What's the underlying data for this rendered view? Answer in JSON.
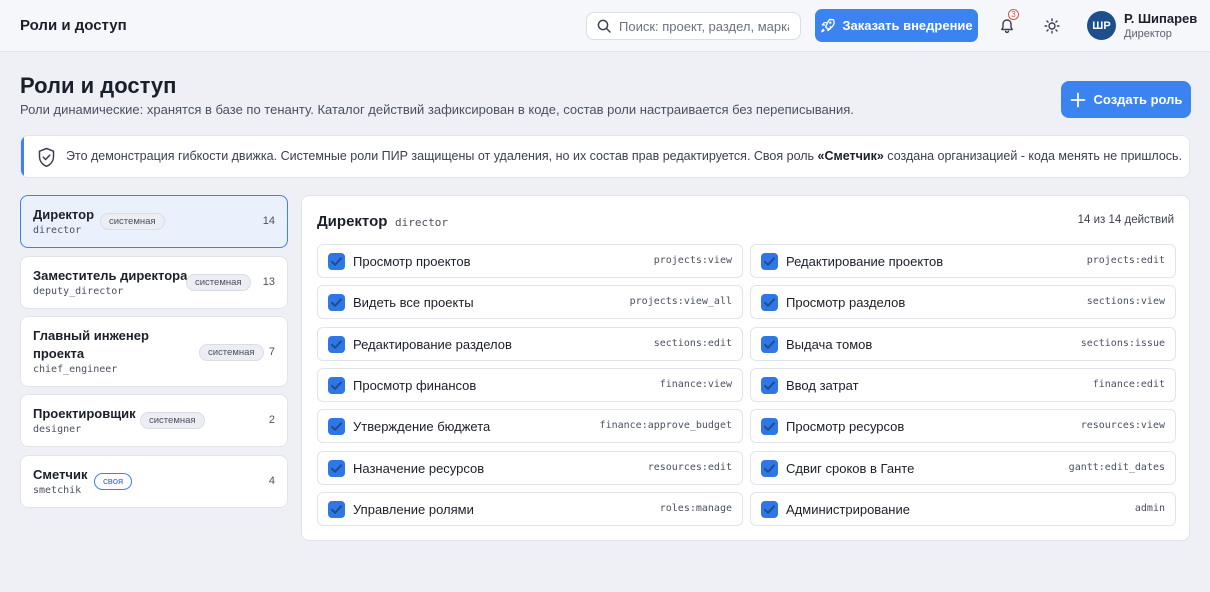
{
  "app": {
    "title": "Роли и доступ"
  },
  "search": {
    "placeholder": "Поиск: проект, раздел, марка"
  },
  "topbar": {
    "order_label": "Заказать внедрение",
    "notifications_count": "3",
    "user_initials": "ШР",
    "user_name": "Р. Шипарев",
    "user_role": "Директор"
  },
  "header": {
    "title": "Роли и доступ",
    "subtitle": "Роли динамические: хранятся в базе по тенанту. Каталог действий зафиксирован в коде, состав роли настраивается без переписывания.",
    "create_label": "Создать роль"
  },
  "banner": {
    "text_before": "Это демонстрация гибкости движка. Системные роли ПИР защищены от удаления, но их состав прав редактируется. Своя роль ",
    "highlight": "«Сметчик»",
    "text_after": " создана организацией - кода менять не пришлось."
  },
  "roles": [
    {
      "name": "Директор",
      "code": "director",
      "tag": "системная",
      "count": "14",
      "active": true
    },
    {
      "name": "Заместитель директора",
      "code": "deputy_director",
      "tag": "системная",
      "count": "13",
      "active": false
    },
    {
      "name_line1": "Главный инженер",
      "name_line2": "проекта",
      "code": "chief_engineer",
      "tag": "системная",
      "count": "7",
      "active": false
    },
    {
      "name": "Проектировщик",
      "code": "designer",
      "tag": "системная",
      "count": "2",
      "active": false
    },
    {
      "name": "Сметчик",
      "code": "smetchik",
      "tag": "своя",
      "count": "4",
      "active": false
    }
  ],
  "detail": {
    "title": "Директор",
    "code": "director",
    "summary": "14 из 14 действий",
    "permissions": [
      {
        "label": "Просмотр проектов",
        "key": "projects:view",
        "checked": true
      },
      {
        "label": "Редактирование проектов",
        "key": "projects:edit",
        "checked": true
      },
      {
        "label": "Видеть все проекты",
        "key": "projects:view_all",
        "checked": true
      },
      {
        "label": "Просмотр разделов",
        "key": "sections:view",
        "checked": true
      },
      {
        "label": "Редактирование разделов",
        "key": "sections:edit",
        "checked": true
      },
      {
        "label": "Выдача томов",
        "key": "sections:issue",
        "checked": true
      },
      {
        "label": "Просмотр финансов",
        "key": "finance:view",
        "checked": true
      },
      {
        "label": "Ввод затрат",
        "key": "finance:edit",
        "checked": true
      },
      {
        "label": "Утверждение бюджета",
        "key": "finance:approve_budget",
        "checked": true
      },
      {
        "label": "Просмотр ресурсов",
        "key": "resources:view",
        "checked": true
      },
      {
        "label": "Назначение ресурсов",
        "key": "resources:edit",
        "checked": true
      },
      {
        "label": "Сдвиг сроков в Ганте",
        "key": "gantt:edit_dates",
        "checked": true
      },
      {
        "label": "Управление ролями",
        "key": "roles:manage",
        "checked": true
      },
      {
        "label": "Администрирование",
        "key": "admin",
        "checked": true
      }
    ]
  },
  "colors": {
    "accent": "#3a83f0",
    "background": "#eef0f6",
    "active_card": "#eaf1fd"
  }
}
